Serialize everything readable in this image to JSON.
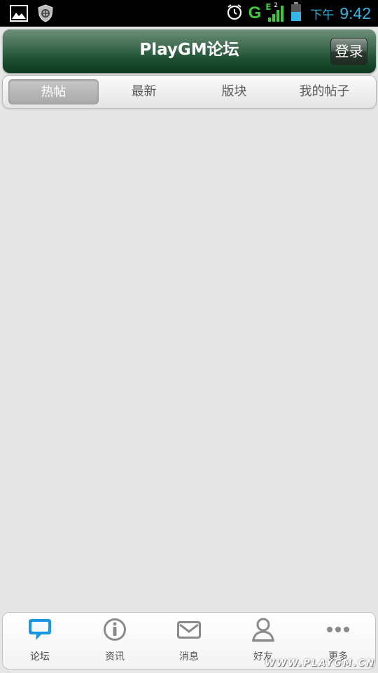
{
  "status_bar": {
    "network_type": "G",
    "network_badge": "E",
    "sim_number": "2",
    "time_prefix": "下午",
    "time": "9:42",
    "icons": [
      "picture-icon",
      "shield-icon",
      "alarm-icon",
      "signal-icon",
      "battery-icon"
    ]
  },
  "header": {
    "title": "PlayGM论坛",
    "login_label": "登录"
  },
  "tabs": [
    {
      "label": "热帖",
      "active": true
    },
    {
      "label": "最新",
      "active": false
    },
    {
      "label": "版块",
      "active": false
    },
    {
      "label": "我的帖子",
      "active": false
    }
  ],
  "bottom_nav": [
    {
      "label": "论坛",
      "icon": "forum-bubble-icon",
      "active": true
    },
    {
      "label": "资讯",
      "icon": "info-icon",
      "active": false
    },
    {
      "label": "消息",
      "icon": "mail-icon",
      "active": false
    },
    {
      "label": "好友",
      "icon": "person-icon",
      "active": false
    },
    {
      "label": "更多",
      "icon": "more-dots-icon",
      "active": false
    }
  ],
  "watermark": "WWW.PLAYGM.CN",
  "colors": {
    "accent_blue": "#1a95e0",
    "header_green": "#184a2c",
    "status_time": "#33b5e5",
    "signal_green": "#3ec83e"
  }
}
